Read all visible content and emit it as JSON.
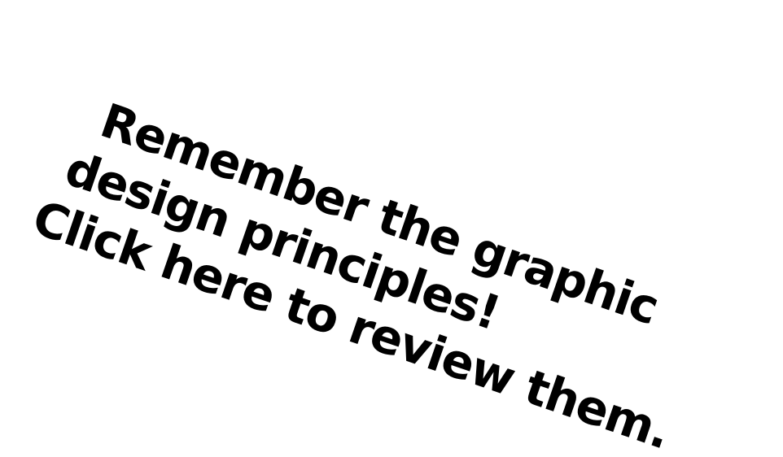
{
  "banner": {
    "line1": "Remember the graphic",
    "line2": "design principles!",
    "line3": "Click here to review them."
  },
  "colors": {
    "background": "#ffffff",
    "text": "#000000"
  }
}
